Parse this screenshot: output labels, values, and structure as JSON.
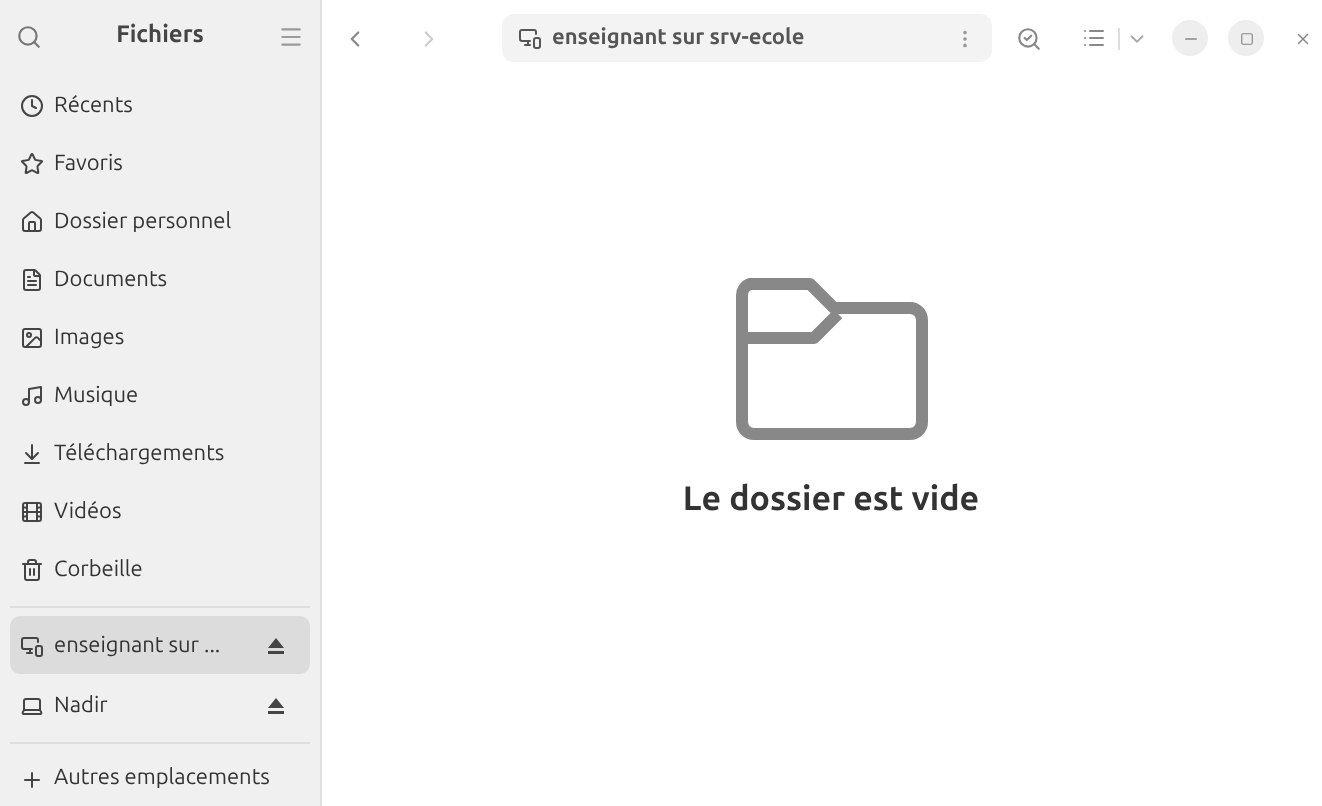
{
  "sidebar": {
    "title": "Fichiers",
    "places": [
      {
        "label": "Récents",
        "selected": false
      },
      {
        "label": "Favoris",
        "selected": false
      },
      {
        "label": "Dossier personnel",
        "selected": false
      },
      {
        "label": "Documents",
        "selected": false
      },
      {
        "label": "Images",
        "selected": false
      },
      {
        "label": "Musique",
        "selected": false
      },
      {
        "label": "Téléchargements",
        "selected": false
      },
      {
        "label": "Vidéos",
        "selected": false
      },
      {
        "label": "Corbeille",
        "selected": false
      }
    ],
    "devices": [
      {
        "label": "enseignant sur ...",
        "selected": true,
        "ejectable": true
      },
      {
        "label": "Nadir",
        "selected": false,
        "ejectable": true
      }
    ],
    "other": {
      "label": "Autres emplacements"
    }
  },
  "toolbar": {
    "location": "enseignant sur srv-ecole",
    "back_disabled": false,
    "forward_disabled": true
  },
  "empty_state": {
    "message": "Le dossier est vide"
  }
}
